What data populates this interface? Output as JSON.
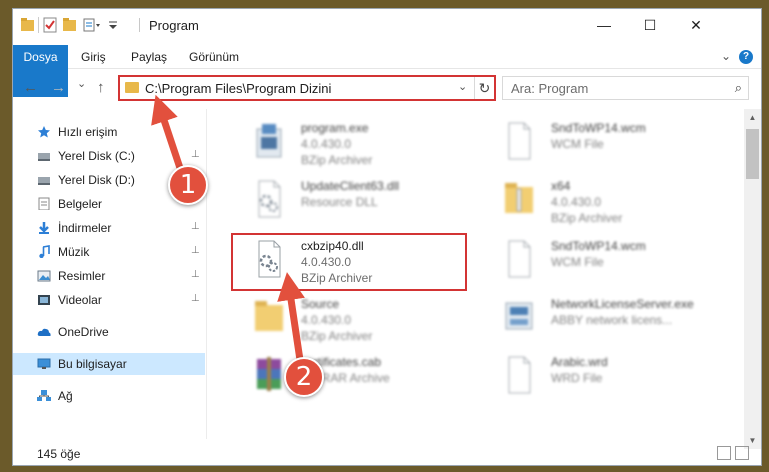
{
  "titlebar": {
    "title": "Program",
    "quick_access": [
      "folder-icon",
      "properties-check-icon",
      "new-folder-icon",
      "customize-icon",
      "dropdown-arrow-icon"
    ],
    "controls": {
      "minimize": "—",
      "maximize": "☐",
      "close": "✕"
    }
  },
  "ribbon": {
    "tabs": [
      {
        "label": "Dosya"
      },
      {
        "label": "Giriş"
      },
      {
        "label": "Paylaş"
      },
      {
        "label": "Görünüm"
      }
    ],
    "expand_icon": "chevron-down-icon",
    "help": "?"
  },
  "navbar": {
    "back": "←",
    "forward": "→",
    "recent": "⌄",
    "up": "↑",
    "address": "C:\\Program Files\\Program Dizini",
    "refresh": "↻",
    "search_placeholder": "Ara: Program",
    "search_icon": "search-icon"
  },
  "sidebar": {
    "items": [
      {
        "label": "Hızlı erişim",
        "icon": "star-icon",
        "pinned": false
      },
      {
        "label": "Yerel Disk (C:)",
        "icon": "drive-icon",
        "pinned": true
      },
      {
        "label": "Yerel Disk (D:)",
        "icon": "drive-icon",
        "pinned": false
      },
      {
        "label": "Belgeler",
        "icon": "documents-icon",
        "pinned": false
      },
      {
        "label": "İndirmeler",
        "icon": "download-icon",
        "pinned": true
      },
      {
        "label": "Müzik",
        "icon": "music-icon",
        "pinned": true
      },
      {
        "label": "Resimler",
        "icon": "pictures-icon",
        "pinned": true
      },
      {
        "label": "Videolar",
        "icon": "videos-icon",
        "pinned": true
      },
      {
        "label": "OneDrive",
        "icon": "cloud-icon",
        "pinned": false
      },
      {
        "label": "Bu bilgisayar",
        "icon": "computer-icon",
        "pinned": false,
        "selected": true
      },
      {
        "label": "Ağ",
        "icon": "network-icon",
        "pinned": false
      }
    ],
    "pin_glyph": "📌"
  },
  "files": [
    {
      "name": "program.exe",
      "line2": "4.0.430.0",
      "line3": "BZip Archiver",
      "icon": "exe-icon"
    },
    {
      "name": "SndToWP14.wcm",
      "line2": "WCM File",
      "line3": "",
      "icon": "blank-file-icon"
    },
    {
      "name": "UpdateClient63.dll",
      "line2": "Resource DLL",
      "line3": "",
      "icon": "dll-gear-icon"
    },
    {
      "name": "x64",
      "line2": "4.0.430.0",
      "line3": "BZip Archiver",
      "icon": "folder-zip-icon"
    },
    {
      "name": "cxbzip40.dll",
      "line2": "4.0.430.0",
      "line3": "BZip Archiver",
      "icon": "dll-gear-icon",
      "highlighted": true
    },
    {
      "name": "SndToWP14.wcm",
      "line2": "WCM File",
      "line3": "",
      "icon": "blank-file-icon"
    },
    {
      "name": "Source",
      "line2": "4.0.430.0",
      "line3": "BZip Archiver",
      "icon": "folder-icon"
    },
    {
      "name": "NetworkLicenseServer.exe",
      "line2": "ABBY network licens...",
      "line3": "",
      "icon": "exe-network-icon"
    },
    {
      "name": "certificates.cab",
      "line2": "WinRAR Archive",
      "line3": "",
      "icon": "winrar-icon"
    },
    {
      "name": "Arabic.wrd",
      "line2": "WRD File",
      "line3": "",
      "icon": "blank-file-icon"
    }
  ],
  "status": {
    "count": "145 öğe",
    "view_icons": [
      "details-view-icon",
      "large-icons-view-icon"
    ]
  },
  "annotations": {
    "marker1": "1",
    "marker2": "2",
    "color": "#e2503d"
  },
  "colors": {
    "accent": "#1979ca",
    "highlight": "#d33434",
    "selected_nav": "#cce8ff"
  }
}
